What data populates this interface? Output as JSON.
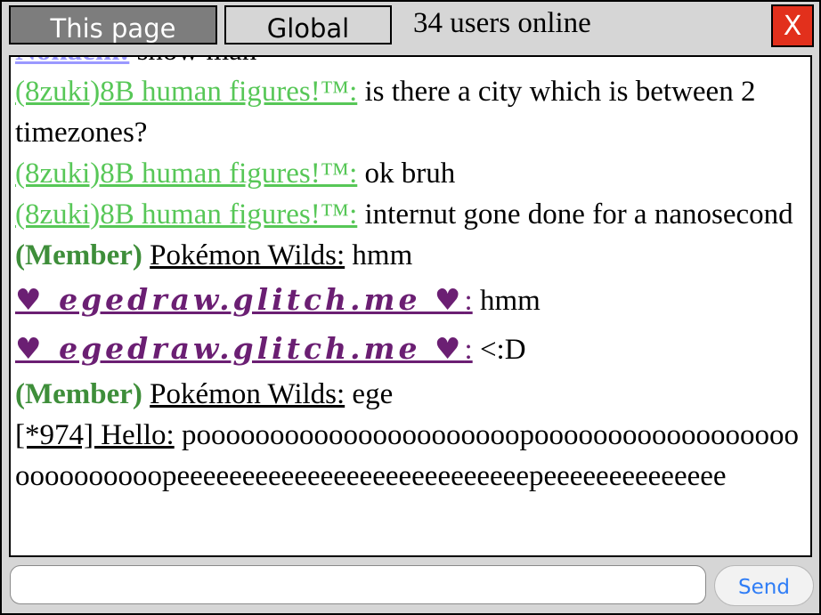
{
  "header": {
    "tabs": [
      {
        "label": "This page",
        "active": true
      },
      {
        "label": "Global",
        "active": false
      }
    ],
    "online_count": "34 users online",
    "close_label": "X"
  },
  "messages": [
    {
      "user": "Nonaem:",
      "text": " snow man",
      "style": "lavender"
    },
    {
      "user": "(8zuki)8B human figures!™:",
      "text": " is there a city which is between 2 timezones?",
      "style": "green"
    },
    {
      "user": "(8zuki)8B human figures!™:",
      "text": " ok bruh",
      "style": "green"
    },
    {
      "user": "(8zuki)8B human figures!™:",
      "text": " internut gone done for a nanosecond",
      "style": "green"
    },
    {
      "rank": "(Member)",
      "user": "Pokémon Wilds:",
      "text": " hmm",
      "style": "plain"
    },
    {
      "user": "♥ egedraw.glitch.me ♥",
      "suffix": ":",
      "text": " hmm",
      "style": "purple"
    },
    {
      "user": "♥ egedraw.glitch.me ♥",
      "suffix": ":",
      "text": " <:D",
      "style": "purple"
    },
    {
      "rank": "(Member)",
      "user": "Pokémon Wilds:",
      "text": " ege",
      "style": "plain"
    },
    {
      "user": "[*974] Hello:",
      "text": " poooooooooooooooooooooopoooooooooooooooooooooooooooopeeeeeeeeeeeeeeeeeeeeeeeeeeepeeeeeeeeeeeeee",
      "style": "plain"
    }
  ],
  "composer": {
    "input_value": "",
    "input_placeholder": "",
    "send_label": "Send"
  },
  "colors": {
    "accent_close": "#e2301c",
    "send_text": "#2f7df6",
    "user_green": "#57c757",
    "rank_green": "#3e8e3a",
    "user_purple": "#6b1f73",
    "user_lavender": "#9a98ff"
  }
}
